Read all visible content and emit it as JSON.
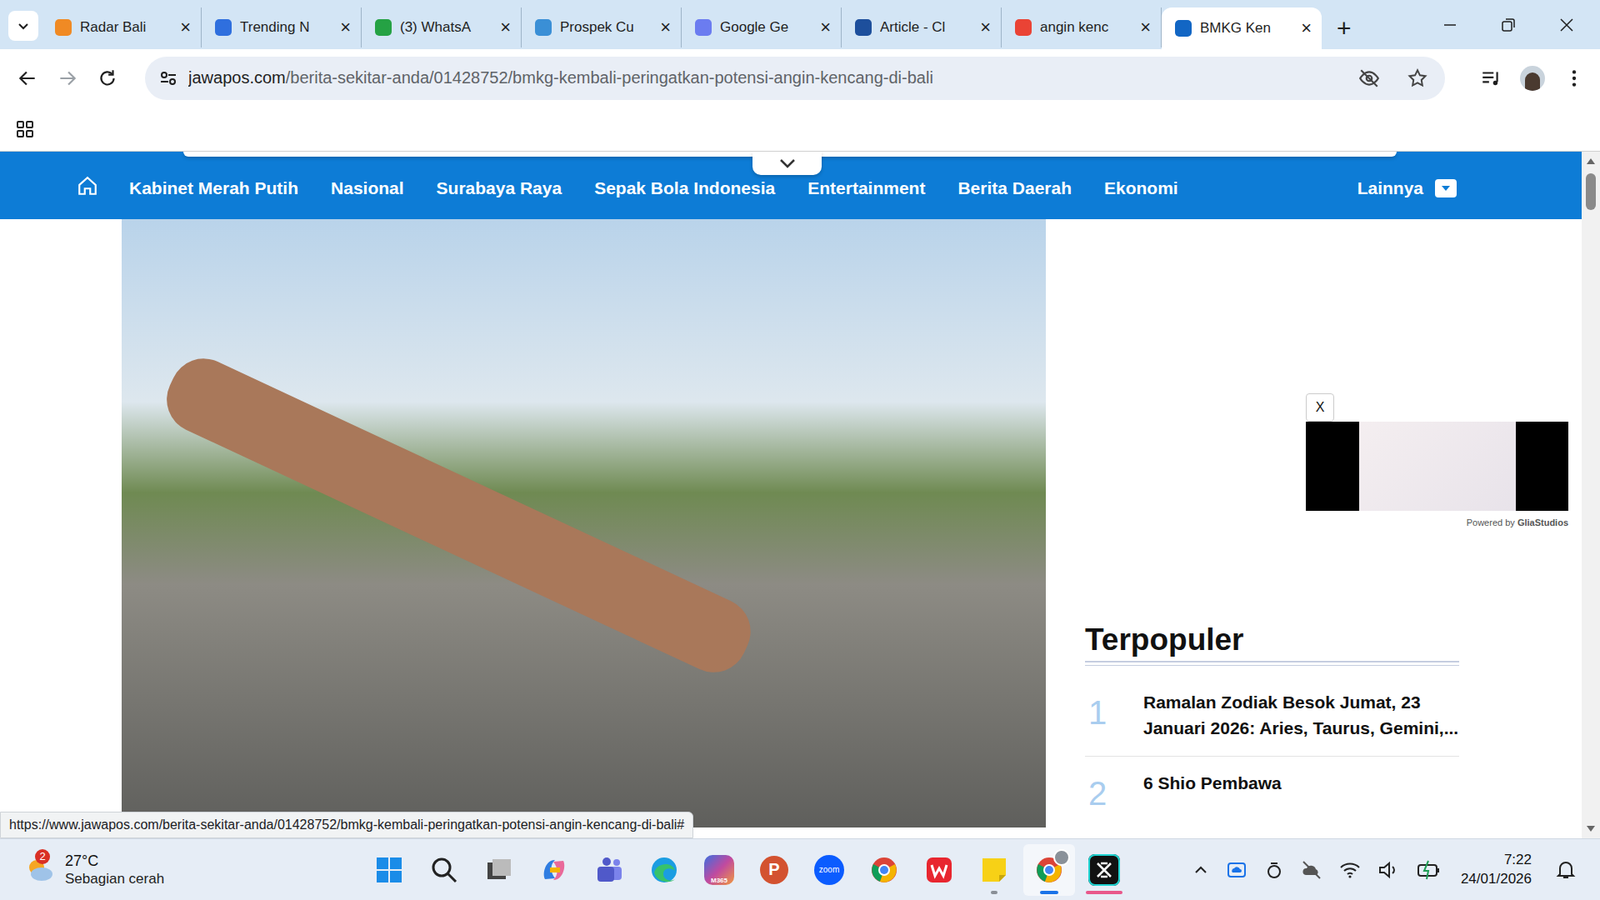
{
  "browser": {
    "tabs": [
      {
        "label": "Radar Bali",
        "selected": false,
        "color": "#f08a24"
      },
      {
        "label": "Trending N",
        "selected": false,
        "color": "#2f6fde"
      },
      {
        "label": "(3) WhatsA",
        "selected": false,
        "color": "#25a244"
      },
      {
        "label": "Prospek Cu",
        "selected": false,
        "color": "#3a8fd6"
      },
      {
        "label": "Google Ge",
        "selected": false,
        "color": "#6b7cf0"
      },
      {
        "label": "Article - Cl",
        "selected": false,
        "color": "#1d4f9c"
      },
      {
        "label": "angin kenc",
        "selected": false,
        "color": "#ea4335"
      },
      {
        "label": "BMKG Ken",
        "selected": true,
        "color": "#1266c4"
      }
    ],
    "close_glyph": "×",
    "new_tab": "+",
    "url_domain": "jawapos.com",
    "url_path": "/berita-sekitar-anda/01428752/bmkg-kembali-peringatkan-potensi-angin-kencang-di-bali"
  },
  "nav": {
    "items": [
      "Kabinet Merah Putih",
      "Nasional",
      "Surabaya Raya",
      "Sepak Bola Indonesia",
      "Entertainment",
      "Berita Daerah",
      "Ekonomi"
    ],
    "more": "Lainnya"
  },
  "ad": {
    "close": "X",
    "powered_by": "Powered by ",
    "brand": "GliaStudios"
  },
  "popular": {
    "title": "Terpopuler",
    "items": [
      {
        "rank": "1",
        "title": "Ramalan Zodiak Besok Jumat, 23 Januari 2026: Aries, Taurus, Gemini,..."
      },
      {
        "rank": "2",
        "title": "6 Shio Pembawa"
      }
    ]
  },
  "status_url": "https://www.jawapos.com/berita-sekitar-anda/01428752/bmkg-kembali-peringatkan-potensi-angin-kencang-di-bali#",
  "taskbar": {
    "weather": {
      "badge": "2",
      "temp": "27°C",
      "desc": "Sebagian cerah"
    },
    "apps": [
      {
        "kind": "start",
        "label": "",
        "running": false,
        "focused": false
      },
      {
        "kind": "search",
        "label": "",
        "running": false,
        "focused": false
      },
      {
        "kind": "taskview",
        "label": "",
        "running": false,
        "focused": false
      },
      {
        "kind": "copilot",
        "label": "",
        "running": false,
        "focused": false
      },
      {
        "kind": "teams",
        "label": "",
        "running": false,
        "focused": false
      },
      {
        "kind": "edge",
        "label": "",
        "running": false,
        "focused": false
      },
      {
        "kind": "m365",
        "label": "M365",
        "running": false,
        "focused": false
      },
      {
        "kind": "powerpoint",
        "label": "P",
        "running": false,
        "focused": false
      },
      {
        "kind": "zoom",
        "label": "zoom",
        "running": false,
        "focused": false
      },
      {
        "kind": "chrome",
        "label": "",
        "running": false,
        "focused": false
      },
      {
        "kind": "wps",
        "label": "",
        "running": false,
        "focused": false
      },
      {
        "kind": "sticky",
        "label": "",
        "running": true,
        "focused": false
      },
      {
        "kind": "chrome-profile",
        "label": "",
        "running": true,
        "focused": true
      },
      {
        "kind": "capcut",
        "label": "",
        "running": true,
        "focused": false
      }
    ],
    "time": "7:22",
    "date": "24/01/2026"
  }
}
